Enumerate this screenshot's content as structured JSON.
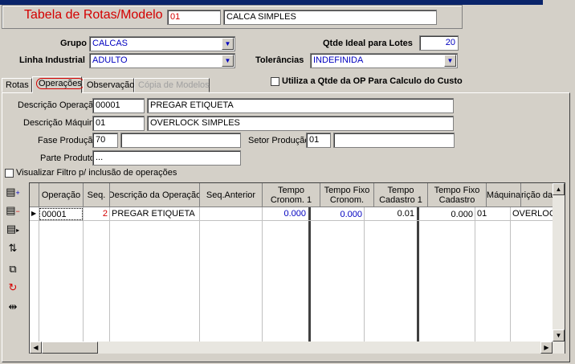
{
  "header": {
    "title": "Tabela de Rotas/Modelo",
    "code": "01",
    "description": "CALCA SIMPLES"
  },
  "form": {
    "grupo_label": "Grupo",
    "grupo_value": "CALCAS",
    "linha_label": "Linha Industrial",
    "linha_value": "ADULTO",
    "qtde_label": "Qtde Ideal para Lotes",
    "qtde_value": "20",
    "tolerancias_label": "Tolerâncias",
    "tolerancias_value": "INDEFINIDA",
    "utiliza_label": "Utiliza a Qtde da OP Para Calculo do Custo"
  },
  "tabs": [
    {
      "label": "Rotas"
    },
    {
      "label": "Operações"
    },
    {
      "label": "Observação"
    },
    {
      "label": "Cópia de Modelos"
    }
  ],
  "operacoes": {
    "desc_op_label": "Descrição Operação",
    "desc_op_code": "00001",
    "desc_op_value": "PREGAR ETIQUETA",
    "desc_maq_label": "Descrição Máquina",
    "desc_maq_code": "01",
    "desc_maq_value": "OVERLOCK SIMPLES",
    "fase_label": "Fase Produção",
    "fase_code": "70",
    "fase_value": "",
    "setor_label": "Setor Produção",
    "setor_code": "01",
    "setor_value": "",
    "parte_label": "Parte Produto",
    "parte_value": "...",
    "filtro_label": "Visualizar Filtro p/ inclusão de operações"
  },
  "grid": {
    "headers": [
      "Operação",
      "Seq.",
      "Descrição da Operação",
      "Seq.Anterior",
      "Tempo\nCronom. 1",
      "Tempo Fixo\nCronom.",
      "Tempo\nCadastro 1",
      "Tempo Fixo\nCadastro",
      "Máquina",
      "rição da Máq"
    ],
    "rows": [
      {
        "operacao": "00001",
        "seq": "2",
        "descricao": "PREGAR ETIQUETA",
        "seq_anterior": "",
        "tempo_cronom": "0.000",
        "tempo_fixo_cronom": "0.000",
        "tempo_cadastro": "0.01",
        "tempo_fixo_cadastro": "0.000",
        "maquina": "01",
        "descricao_maquina": "OVERLOCK"
      }
    ]
  },
  "colors": {
    "title": "#d40000",
    "value_blue": "#0000c0",
    "titlebar": "#0a246a"
  }
}
